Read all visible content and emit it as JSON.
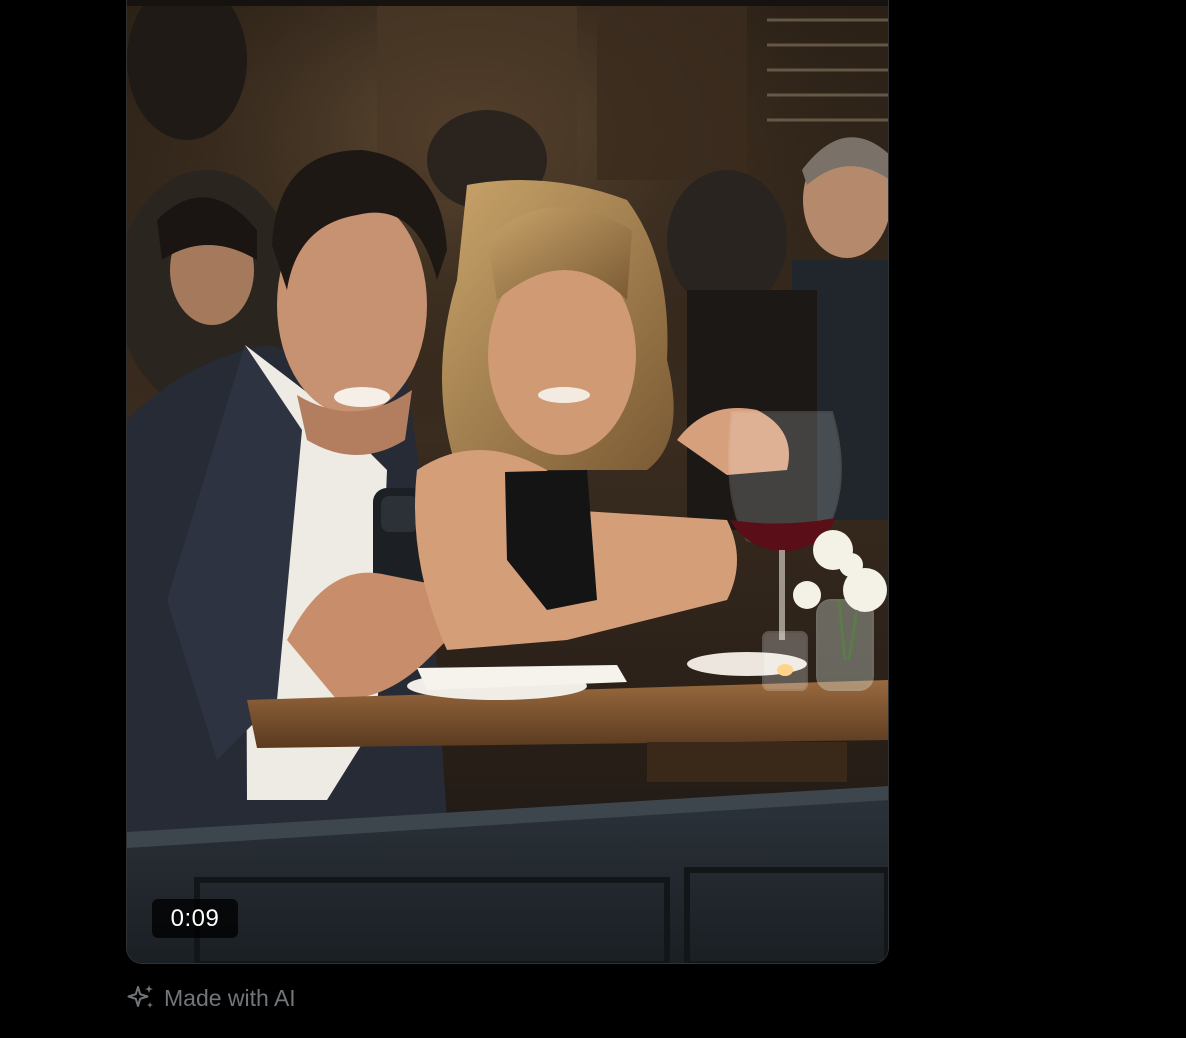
{
  "video": {
    "duration": "0:09",
    "description_icon": "sparkle-icon",
    "ai_label": "Made with AI"
  },
  "colors": {
    "background": "#000000",
    "accent": "#1d9bf0",
    "muted_text": "#71767b",
    "card_border": "#2f3336"
  }
}
